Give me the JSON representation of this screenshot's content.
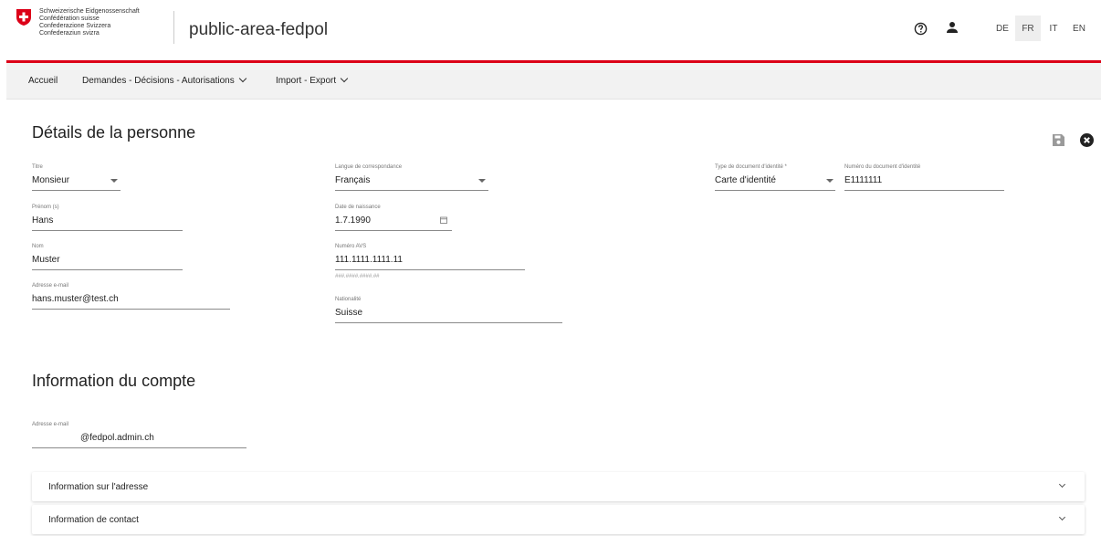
{
  "header": {
    "org_lines": [
      "Schweizerische Eidgenossenschaft",
      "Confédération suisse",
      "Confederazione Svizzera",
      "Confederaziun svizra"
    ],
    "app_title": "public-area-fedpol",
    "icons": {
      "help": "help-circle-icon",
      "user": "user-icon"
    },
    "languages": [
      "DE",
      "FR",
      "IT",
      "EN"
    ],
    "active_language": "FR",
    "accent_color": "#dc0018"
  },
  "nav": {
    "items": [
      {
        "label": "Accueil",
        "has_dropdown": false
      },
      {
        "label": "Demandes - Décisions - Autorisations",
        "has_dropdown": true
      },
      {
        "label": "Import - Export",
        "has_dropdown": true
      }
    ]
  },
  "person": {
    "title": "Détails de la personne",
    "fields": {
      "titre": {
        "label": "Titre",
        "value": "Monsieur"
      },
      "prenom": {
        "label": "Prénom (s)",
        "value": "Hans"
      },
      "nom": {
        "label": "Nom",
        "value": "Muster"
      },
      "email": {
        "label": "Adresse e-mail",
        "value": "hans.muster@test.ch"
      },
      "langue": {
        "label": "Langue de correspondance",
        "value": "Français"
      },
      "naissance": {
        "label": "Date de naissance",
        "value": "1.7.1990"
      },
      "avs": {
        "label": "Numéro AVS",
        "value": "111.1111.1111.11",
        "hint": "###.####.####.##"
      },
      "nationalite": {
        "label": "Nationalité",
        "value": "Suisse"
      },
      "type_doc": {
        "label": "Type de document d'identité *",
        "value": "Carte d'identité"
      },
      "num_doc": {
        "label": "Numéro du document d'identité",
        "value": "E1111111"
      }
    }
  },
  "account": {
    "title": "Information du compte",
    "email": {
      "label": "Adresse e-mail",
      "value": "@fedpol.admin.ch"
    }
  },
  "panels": [
    {
      "label": "Information sur l'adresse"
    },
    {
      "label": "Information de contact"
    }
  ]
}
